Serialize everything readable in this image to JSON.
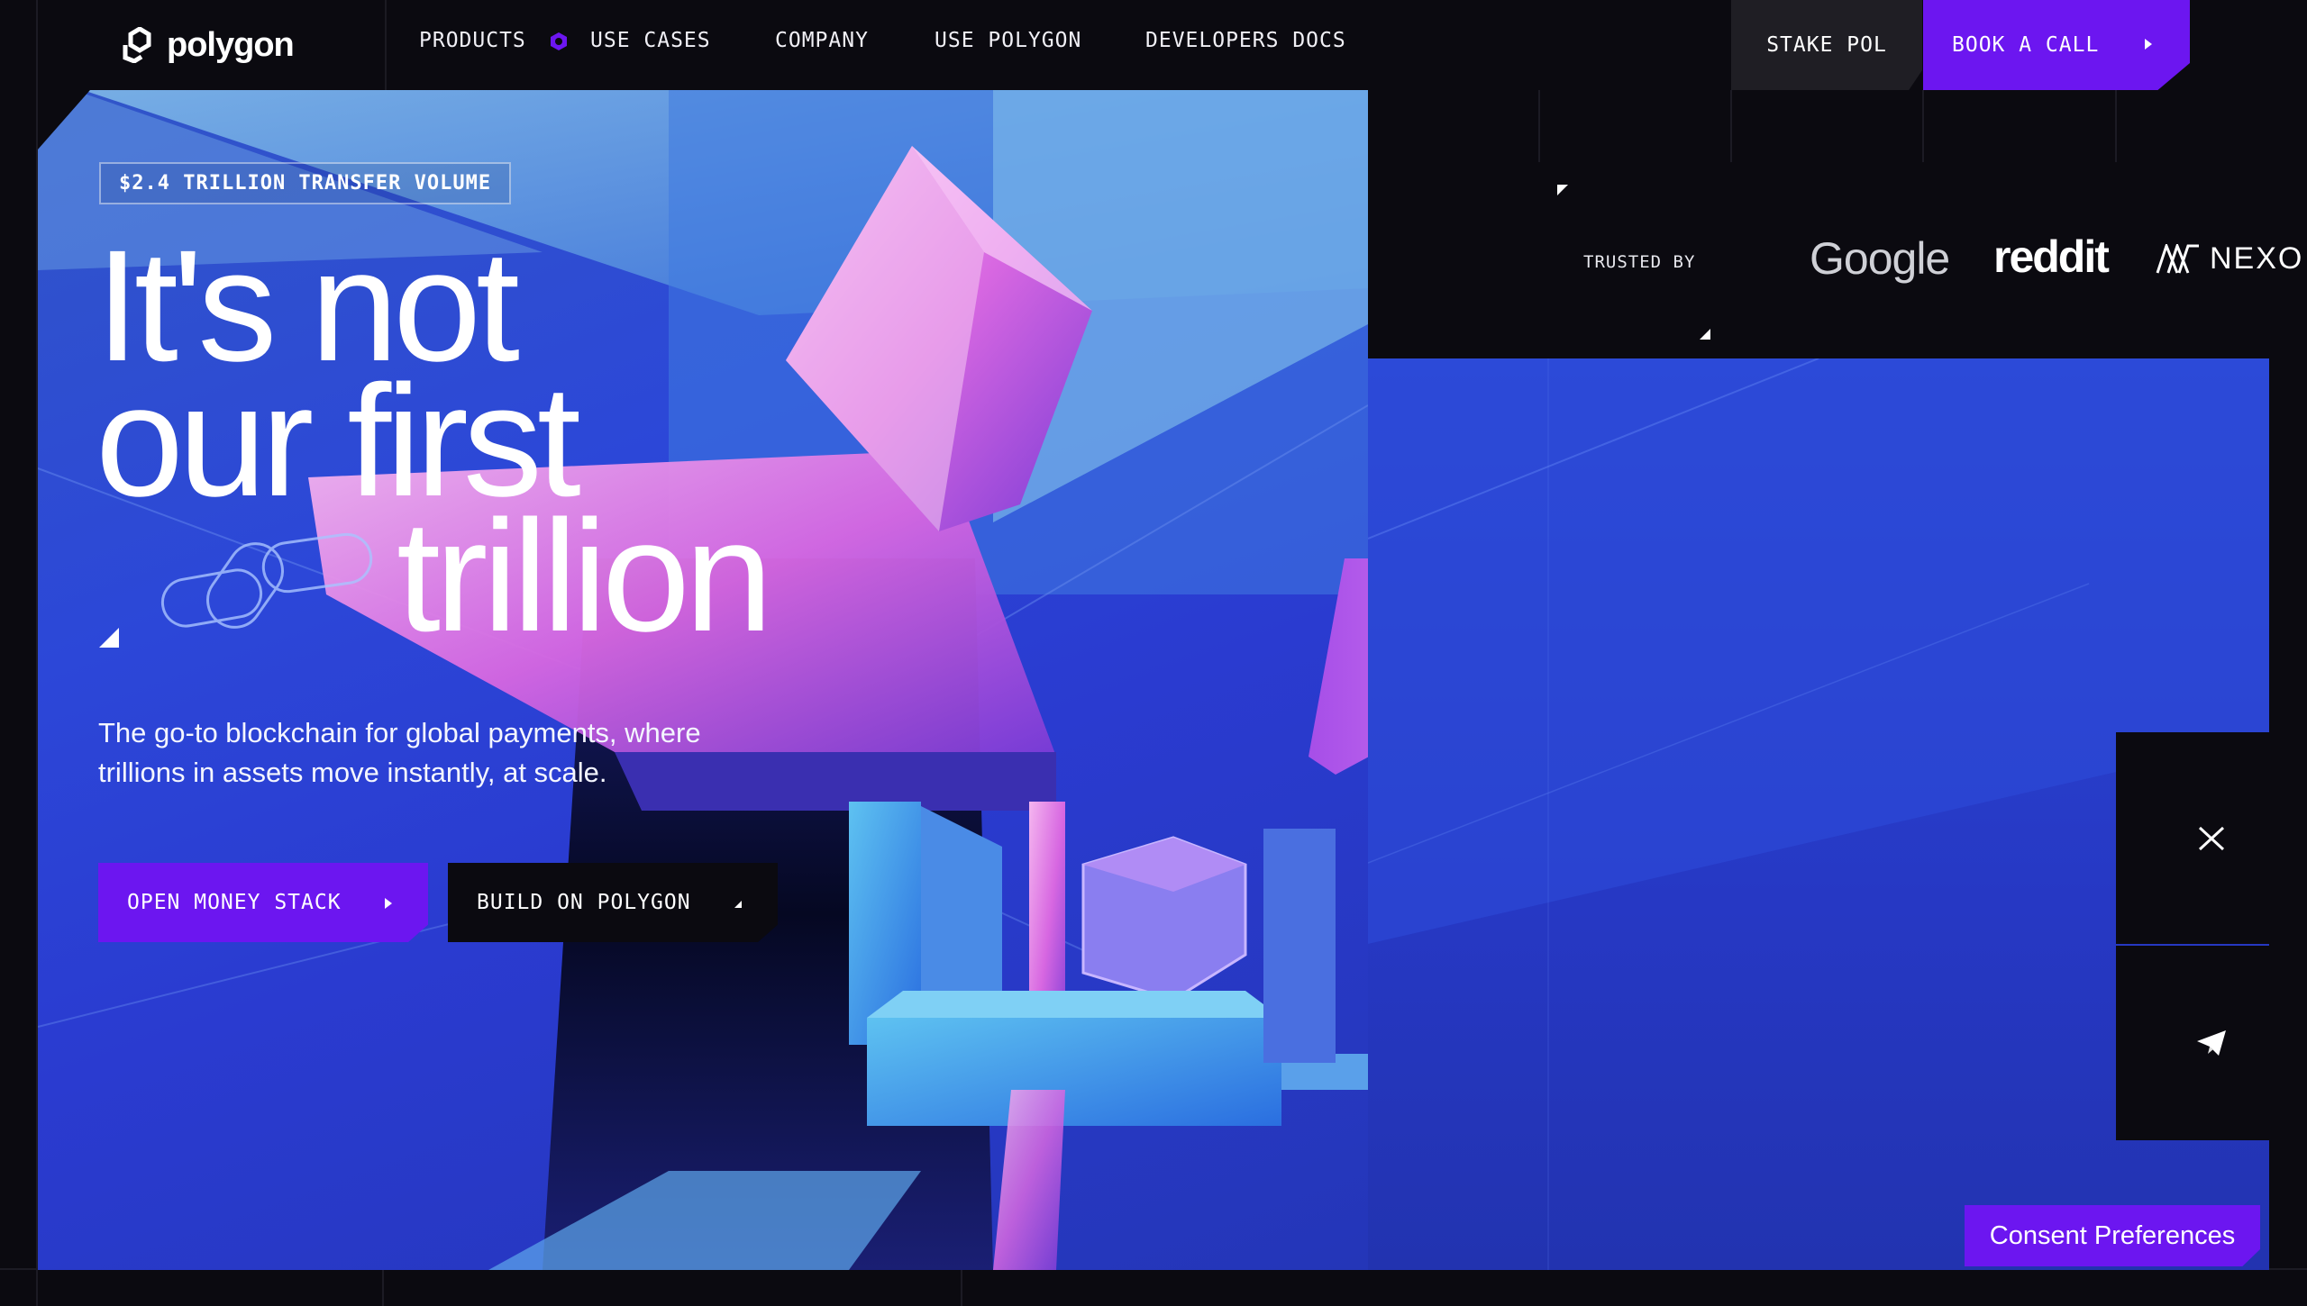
{
  "nav": {
    "logo_text": "polygon",
    "items": [
      {
        "label": "PRODUCTS"
      },
      {
        "label": "USE CASES"
      },
      {
        "label": "COMPANY"
      },
      {
        "label": "USE POLYGON"
      },
      {
        "label": "DEVELOPERS DOCS"
      }
    ],
    "stake_label": "STAKE POL",
    "book_label": "BOOK A CALL"
  },
  "hero": {
    "badge": "$2.4 TRILLION TRANSFER VOLUME",
    "headline_line1": "It's not",
    "headline_line2": "our first",
    "headline_line3": "trillion",
    "subtext": "The go-to blockchain for global payments, where trillions in assets move instantly, at scale.",
    "primary_button": "OPEN MONEY STACK",
    "secondary_button": "BUILD ON POLYGON"
  },
  "trusted": {
    "label": "TRUSTED BY",
    "logos": [
      "Google",
      "reddit",
      "NEXO"
    ]
  },
  "social": [
    "x-icon",
    "telegram-icon"
  ],
  "consent_label": "Consent Preferences",
  "colors": {
    "accent": "#6c16f0",
    "background": "#0b0a10",
    "hero_blue": "#2c47d8",
    "pink": "#e57be6"
  }
}
